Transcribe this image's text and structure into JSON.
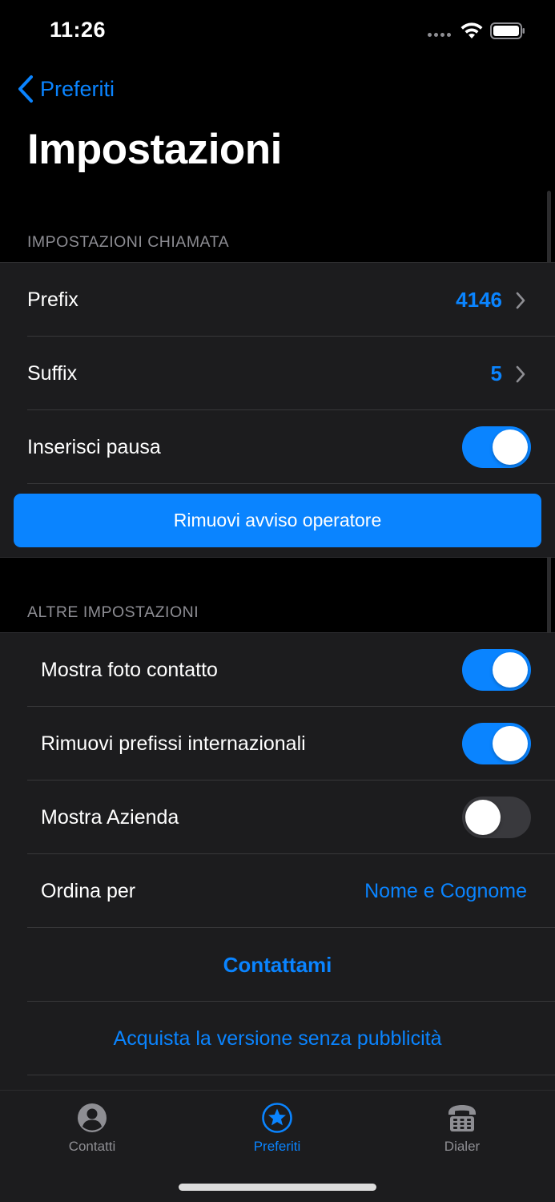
{
  "status_bar": {
    "time": "11:26"
  },
  "nav": {
    "back_label": "Preferiti",
    "title": "Impostazioni"
  },
  "call_settings": {
    "header": "IMPOSTAZIONI CHIAMATA",
    "prefix": {
      "label": "Prefix",
      "value": "4146"
    },
    "suffix": {
      "label": "Suffix",
      "value": "5"
    },
    "insert_pause": {
      "label": "Inserisci pausa",
      "enabled": true
    },
    "remove_operator_button": "Rimuovi avviso operatore"
  },
  "other_settings": {
    "header": "ALTRE IMPOSTAZIONI",
    "show_contact_photo": {
      "label": "Mostra foto contatto",
      "enabled": true
    },
    "remove_international_prefixes": {
      "label": "Rimuovi prefissi internazionali",
      "enabled": true
    },
    "show_company": {
      "label": "Mostra Azienda",
      "enabled": false
    },
    "sort_by": {
      "label": "Ordina per",
      "value": "Nome e Cognome"
    },
    "contact_me": "Contattami",
    "buy_ad_free": "Acquista la versione senza pubblicità"
  },
  "tab_bar": {
    "tabs": [
      {
        "label": "Contatti",
        "icon": "person-circle-icon",
        "active": false
      },
      {
        "label": "Preferiti",
        "icon": "star-circle-icon",
        "active": true
      },
      {
        "label": "Dialer",
        "icon": "telephone-keypad-icon",
        "active": false
      }
    ]
  },
  "colors": {
    "accent": "#0a84ff",
    "background": "#000000",
    "cell_background": "#1c1c1e",
    "secondary_text": "#8e8e93"
  }
}
